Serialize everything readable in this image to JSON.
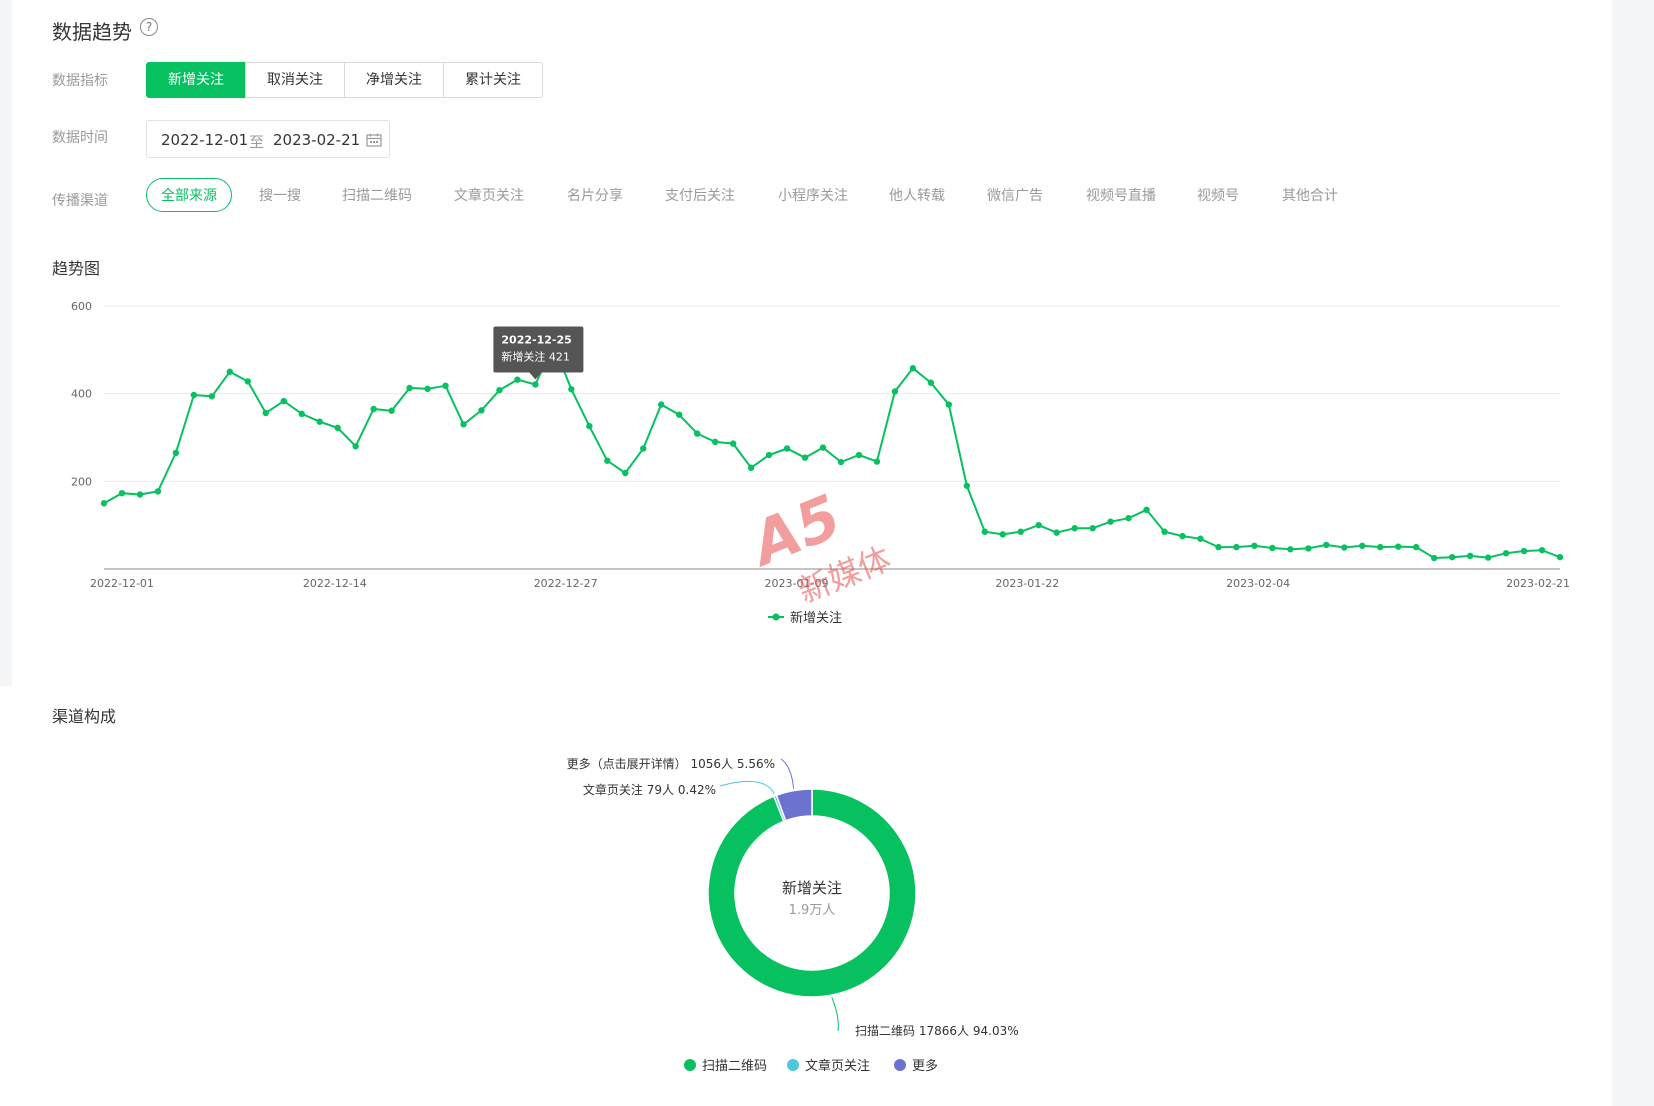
{
  "trend": {
    "title": "数据趋势",
    "help_glyph": "?",
    "metric_label": "数据指标",
    "metrics": [
      "新增关注",
      "取消关注",
      "净增关注",
      "累计关注"
    ],
    "time_label": "数据时间",
    "date_start": "2022-12-01",
    "date_sep": "至",
    "date_end": "2023-02-21",
    "channel_label": "传播渠道",
    "channels": [
      "全部来源",
      "搜一搜",
      "扫描二维码",
      "文章页关注",
      "名片分享",
      "支付后关注",
      "小程序关注",
      "他人转载",
      "微信广告",
      "视频号直播",
      "视频号",
      "其他合计"
    ],
    "chart_title": "趋势图",
    "tooltip_date": "2022-12-25",
    "tooltip_value": "新增关注 421",
    "watermark_big": "A5",
    "watermark_small": "新媒体"
  },
  "channel": {
    "title": "渠道构成"
  },
  "colors": {
    "accent": "#07c160",
    "teal": "#4ec7dc",
    "purple": "#6c72d0"
  },
  "chart_data": [
    {
      "type": "line",
      "title": "",
      "xlabel": "",
      "ylabel": "",
      "ylim": [
        0,
        600
      ],
      "y_ticks": [
        200,
        400,
        600
      ],
      "x_tick_labels": [
        "2022-12-01",
        "2022-12-14",
        "2022-12-27",
        "2023-01-09",
        "2023-01-22",
        "2023-02-04",
        "2023-02-21"
      ],
      "x_start": "2022-12-01",
      "x_end": "2023-02-21",
      "grid": true,
      "legend": "bottom-center",
      "series": [
        {
          "name": "新增关注",
          "color": "#07c160",
          "values": [
            150,
            173,
            170,
            177,
            265,
            397,
            394,
            450,
            428,
            356,
            383,
            354,
            336,
            322,
            280,
            365,
            361,
            413,
            411,
            418,
            330,
            362,
            408,
            432,
            421,
            512,
            410,
            326,
            247,
            219,
            275,
            375,
            352,
            309,
            290,
            286,
            231,
            260,
            275,
            254,
            277,
            244,
            260,
            245,
            405,
            458,
            425,
            375,
            190,
            85,
            79,
            85,
            100,
            83,
            93,
            93,
            108,
            116,
            135,
            85,
            75,
            69,
            50,
            50,
            53,
            48,
            45,
            47,
            55,
            49,
            53,
            50,
            51,
            50,
            25,
            27,
            30,
            26,
            36,
            41,
            43,
            27
          ]
        }
      ]
    },
    {
      "type": "pie",
      "title": "",
      "center_label": "新增关注",
      "center_value": "1.9万人",
      "legend": "bottom-center",
      "slices": [
        {
          "name": "扫描二维码",
          "legend_name": "扫描二维码",
          "value": 17866,
          "unit": "人",
          "percent": "94.03%",
          "color": "#07c160"
        },
        {
          "name": "文章页关注",
          "legend_name": "文章页关注",
          "value": 79,
          "unit": "人",
          "percent": "0.42%",
          "color": "#4ec7dc"
        },
        {
          "name": "更多（点击展开详情）",
          "legend_name": "更多",
          "value": 1056,
          "unit": "人",
          "percent": "5.56%",
          "color": "#6c72d0"
        }
      ]
    }
  ]
}
